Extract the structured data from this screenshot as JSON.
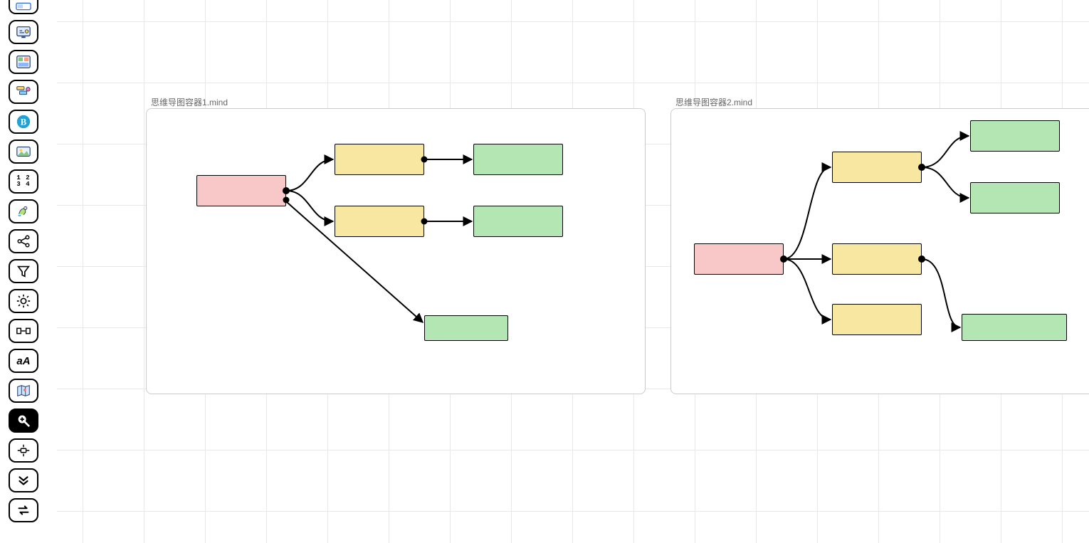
{
  "toolbar": {
    "items": [
      {
        "name": "panel-icon"
      },
      {
        "name": "app-monitor-icon"
      },
      {
        "name": "dashboard-color-icon"
      },
      {
        "name": "tags-color-icon"
      },
      {
        "name": "blogger-b-icon"
      },
      {
        "name": "image-landscape-icon"
      },
      {
        "name": "matrix-numbers-icon"
      },
      {
        "name": "mermaid-icon"
      },
      {
        "name": "graph-nodes-icon"
      },
      {
        "name": "funnel-filter-icon"
      },
      {
        "name": "brightness-icon"
      },
      {
        "name": "split-cells-icon"
      },
      {
        "name": "text-style-icon"
      },
      {
        "name": "map-color-icon"
      },
      {
        "name": "zoom-in-icon"
      },
      {
        "name": "center-focus-icon"
      },
      {
        "name": "double-chevron-down-icon"
      },
      {
        "name": "swap-arrows-icon"
      }
    ],
    "matrix_label_top": "1 2",
    "matrix_label_bottom": "3 4",
    "text_style_label": "aA"
  },
  "containers": [
    {
      "id": 1,
      "label": "思维导图容器1.mind",
      "nodes": {
        "root": {
          "type": "pink"
        },
        "child1": {
          "type": "yellow"
        },
        "child2": {
          "type": "yellow"
        },
        "leaf1": {
          "type": "green"
        },
        "leaf2": {
          "type": "green"
        },
        "leaf3": {
          "type": "green"
        }
      }
    },
    {
      "id": 2,
      "label": "思维导图容器2.mind",
      "nodes": {
        "root": {
          "type": "pink"
        },
        "child1": {
          "type": "yellow"
        },
        "child2": {
          "type": "yellow"
        },
        "child3": {
          "type": "yellow"
        },
        "leaf1": {
          "type": "green"
        },
        "leaf2": {
          "type": "green"
        },
        "leaf3": {
          "type": "green"
        }
      }
    }
  ]
}
